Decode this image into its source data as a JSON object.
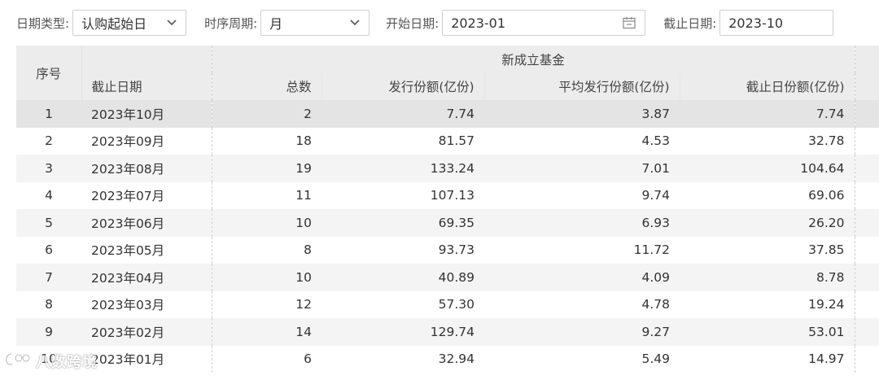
{
  "filters": {
    "date_type_label": "日期类型:",
    "date_type_value": "认购起始日",
    "period_label": "时序周期:",
    "period_value": "月",
    "start_label": "开始日期:",
    "start_value": "2023-01",
    "end_label": "截止日期:",
    "end_value": "2023-10"
  },
  "table": {
    "seq_header": "序号",
    "group_header": "新成立基金",
    "columns": [
      "截止日期",
      "总数",
      "发行份额(亿份)",
      "平均发行份额(亿份)",
      "截止日份额(亿份)"
    ],
    "rows": [
      [
        "1",
        "2023年10月",
        "2",
        "7.74",
        "3.87",
        "7.74"
      ],
      [
        "2",
        "2023年09月",
        "18",
        "81.57",
        "4.53",
        "32.78"
      ],
      [
        "3",
        "2023年08月",
        "19",
        "133.24",
        "7.01",
        "104.64"
      ],
      [
        "4",
        "2023年07月",
        "11",
        "107.13",
        "9.74",
        "69.06"
      ],
      [
        "5",
        "2023年06月",
        "10",
        "69.35",
        "6.93",
        "26.20"
      ],
      [
        "6",
        "2023年05月",
        "8",
        "93.73",
        "11.72",
        "37.85"
      ],
      [
        "7",
        "2023年04月",
        "10",
        "40.89",
        "4.09",
        "8.78"
      ],
      [
        "8",
        "2023年03月",
        "12",
        "57.30",
        "4.78",
        "19.24"
      ],
      [
        "9",
        "2023年02月",
        "14",
        "129.74",
        "9.27",
        "53.01"
      ],
      [
        "10",
        "2023年01月",
        "6",
        "32.94",
        "5.49",
        "14.97"
      ]
    ]
  },
  "watermark": {
    "text": "八数跨境"
  }
}
